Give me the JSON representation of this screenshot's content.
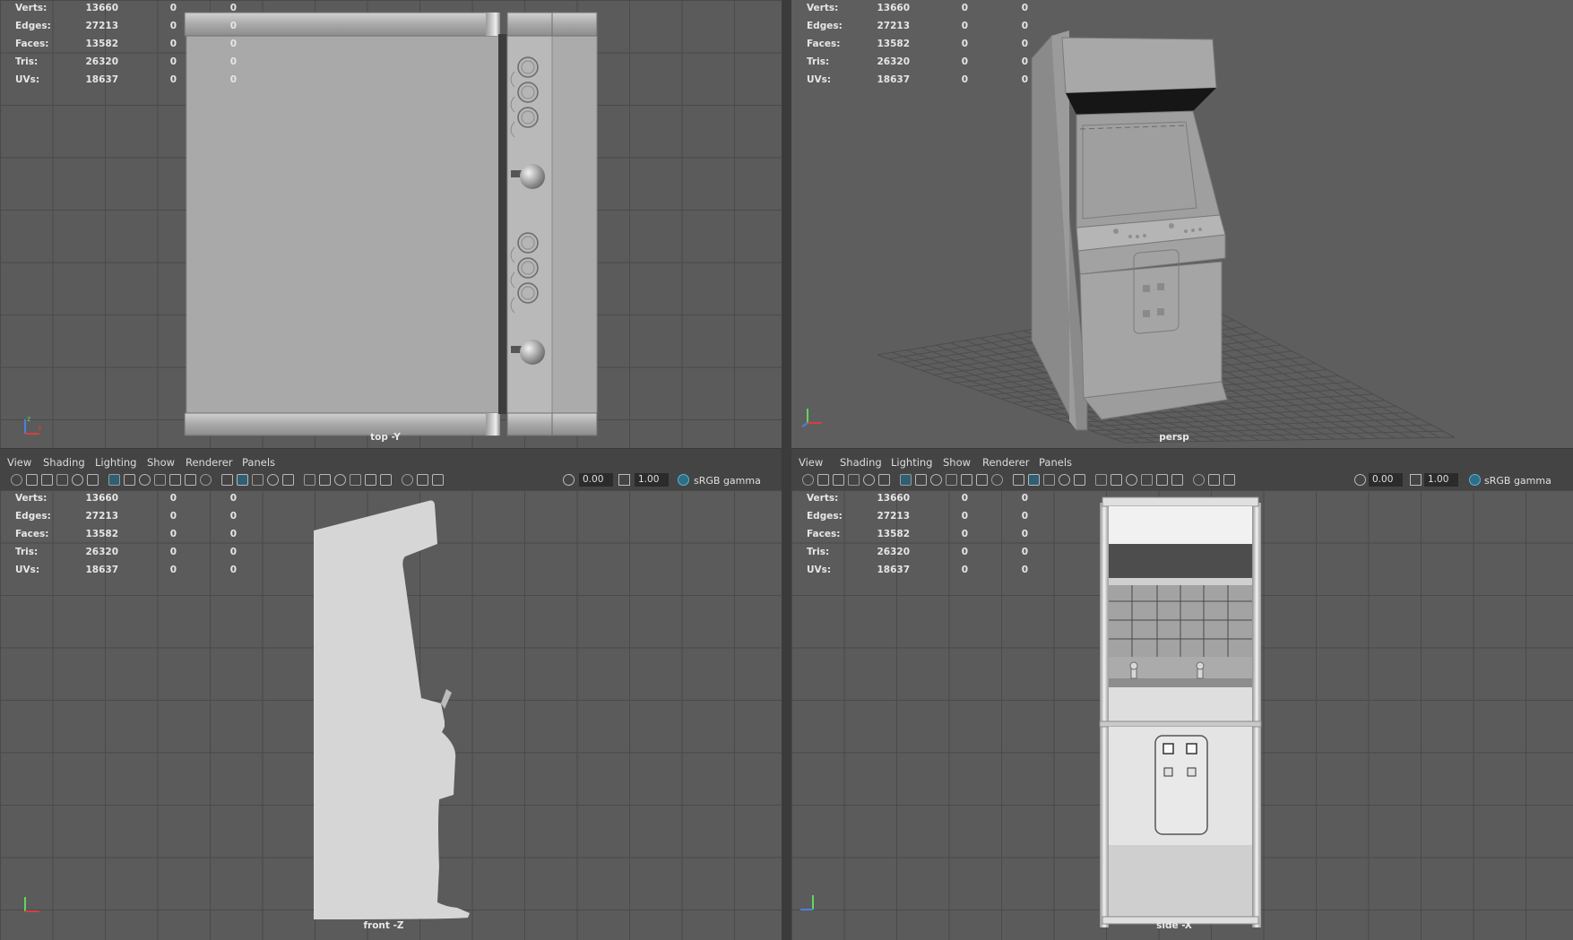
{
  "stats": {
    "labels": [
      "Verts:",
      "Edges:",
      "Faces:",
      "Tris:",
      "UVs:"
    ],
    "values": [
      "13660",
      "27213",
      "13582",
      "26320",
      "18637"
    ],
    "sel": [
      "0",
      "0",
      "0",
      "0",
      "0"
    ],
    "sel2": [
      "0",
      "0",
      "0",
      "0",
      "0"
    ]
  },
  "viewports": {
    "top": {
      "camera": "top -Y"
    },
    "persp": {
      "camera": "persp"
    },
    "front": {
      "camera": "front -Z"
    },
    "side": {
      "camera": "side -X"
    }
  },
  "panel_menu": [
    "View",
    "Shading",
    "Lighting",
    "Show",
    "Renderer",
    "Panels"
  ],
  "toolbar": {
    "exposure": "0.00",
    "gamma": "1.00",
    "color_space": "sRGB gamma"
  },
  "colors": {
    "viewport_bg": "#5b5b5b",
    "grid": "#4a4a4a",
    "accent": "#5ab4d6",
    "axis_x": "#d64040",
    "axis_y": "#5ed65e",
    "axis_z": "#4a7fe0"
  },
  "icons": [
    "camera-icon",
    "camera-attr-icon",
    "bookmark-icon",
    "image-plane-icon",
    "grease-pencil-icon",
    "2d-pan-icon",
    "grid-icon",
    "film-gate-icon",
    "resolution-gate-icon",
    "gate-mask-icon",
    "field-chart-icon",
    "safe-action-icon",
    "safe-title-icon",
    "wireframe-icon",
    "smooth-shade-icon",
    "default-material-icon",
    "wireframe-on-shaded-icon",
    "xray-icon",
    "xray-joints-icon",
    "use-lights-icon",
    "shadows-icon",
    "ambient-occlusion-icon",
    "motion-blur-icon",
    "anti-alias-icon",
    "isolate-select-icon",
    "depth-of-field-icon",
    "hud-icon",
    "exposure-icon",
    "gamma-icon",
    "color-management-icon"
  ]
}
